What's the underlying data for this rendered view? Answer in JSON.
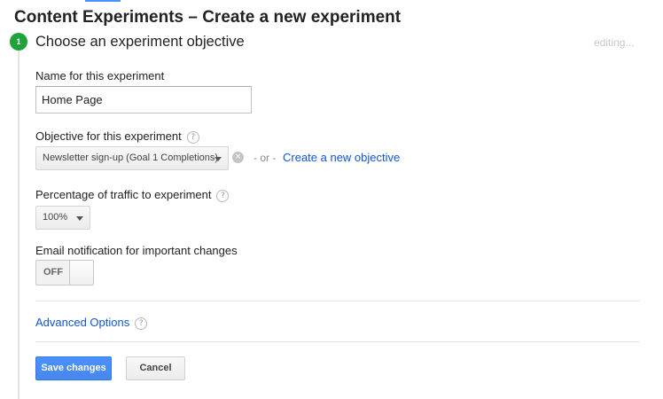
{
  "page": {
    "title": "Content Experiments – Create a new experiment"
  },
  "step": {
    "number": "1",
    "title": "Choose an experiment objective",
    "status": "editing..."
  },
  "name_field": {
    "label": "Name for this experiment",
    "value": "Home Page"
  },
  "objective": {
    "label": "Objective for this experiment",
    "help_icon": "?",
    "selected": "Newsletter sign-up (Goal 1 Completions)",
    "clear_icon": "×",
    "separator": "- or -",
    "create_link": "Create a new objective"
  },
  "traffic": {
    "label": "Percentage of traffic to experiment",
    "help_icon": "?",
    "selected": "100%"
  },
  "email_notification": {
    "label": "Email notification for important changes",
    "toggle_state": "OFF"
  },
  "advanced": {
    "link": "Advanced Options",
    "help_icon": "?"
  },
  "actions": {
    "save_label": "Save changes",
    "cancel_label": "Cancel"
  },
  "colors": {
    "accent_blue": "#4d90fe",
    "link_blue": "#1155cc",
    "step_green": "#1fa33a"
  }
}
